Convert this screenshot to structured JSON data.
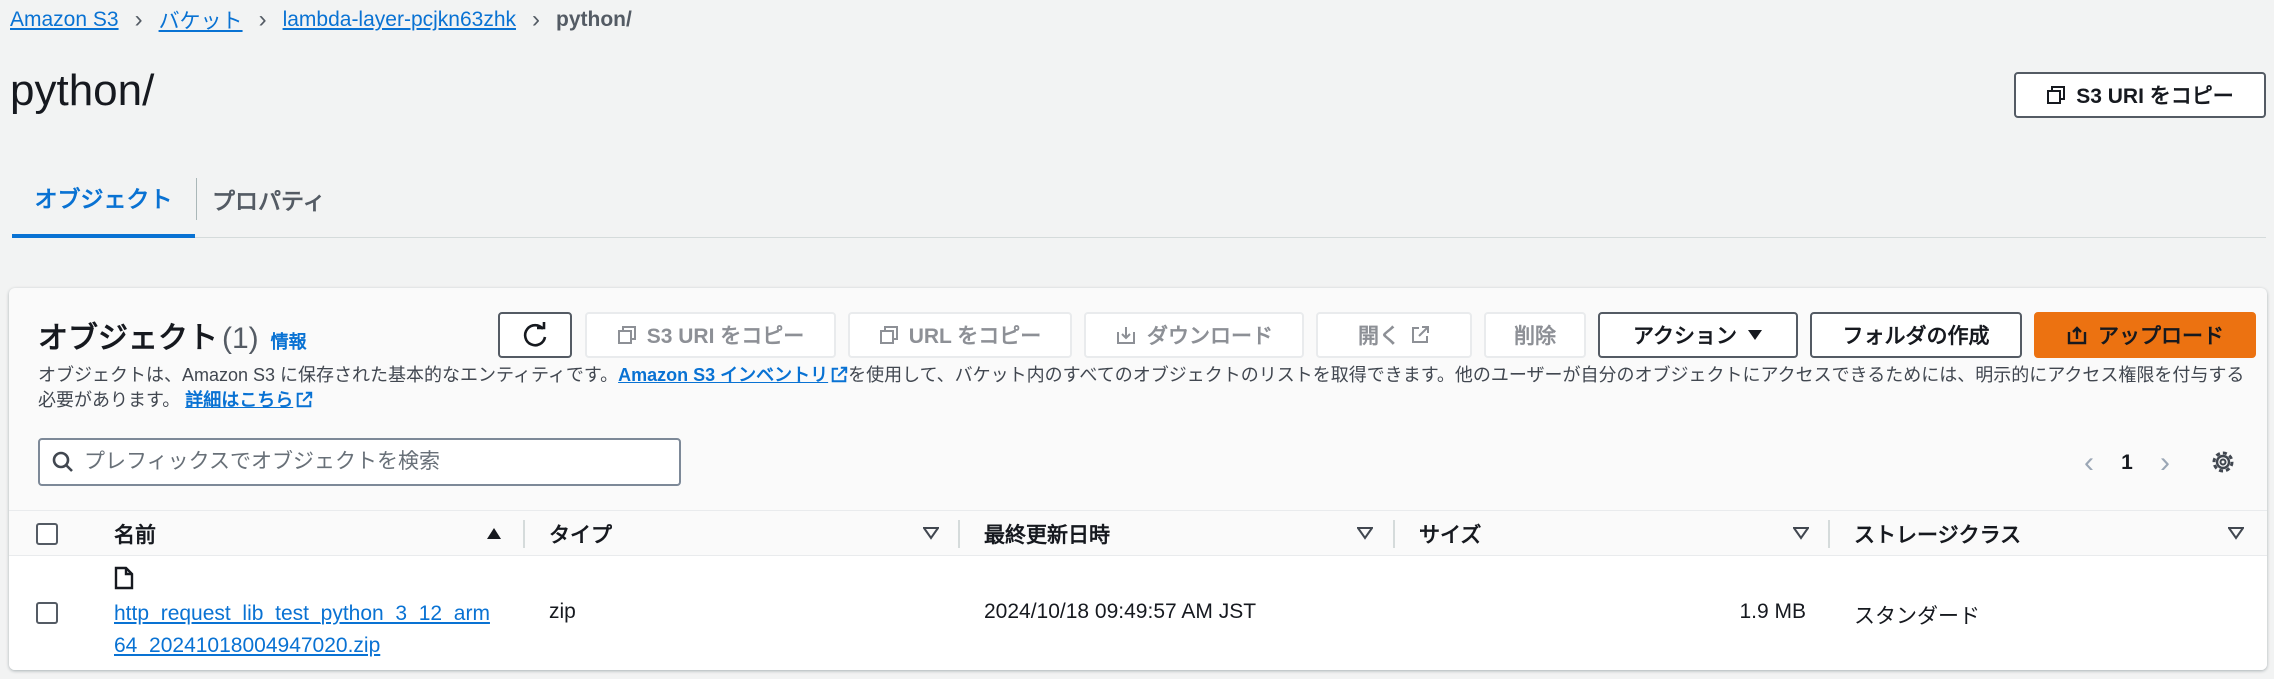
{
  "breadcrumb": {
    "items": [
      "Amazon S3",
      "バケット",
      "lambda-layer-pcjkn63zhk"
    ],
    "current": "python/"
  },
  "page": {
    "title": "python/",
    "copy_uri_label": "S3 URI をコピー"
  },
  "tabs": [
    {
      "label": "オブジェクト",
      "active": true
    },
    {
      "label": "プロパティ",
      "active": false
    }
  ],
  "objects": {
    "title": "オブジェクト",
    "count": "(1)",
    "info": "情報",
    "toolbar": {
      "copy_s3_uri": "S3 URI をコピー",
      "copy_url": "URL をコピー",
      "download": "ダウンロード",
      "open": "開く",
      "delete": "削除",
      "actions": "アクション",
      "create_folder": "フォルダの作成",
      "upload": "アップロード"
    },
    "description": {
      "part1": "オブジェクトは、Amazon S3 に保存された基本的なエンティティです。",
      "inventory_link": "Amazon S3 インベントリ",
      "part2": "を使用して、バケット内のすべてのオブジェクトのリストを取得できます。他のユーザーが自分のオブジェクトにアクセスできるためには、明示的にアクセス権限を付与する必要があります。",
      "details_link": "詳細はこちら"
    },
    "search_placeholder": "プレフィックスでオブジェクトを検索",
    "pagination": {
      "current_page": "1"
    },
    "columns": [
      "名前",
      "タイプ",
      "最終更新日時",
      "サイズ",
      "ストレージクラス"
    ],
    "rows": [
      {
        "name": "http_request_lib_test_python_3_12_arm64_20241018004947020.zip",
        "type": "zip",
        "last_modified": "2024/10/18 09:49:57 AM JST",
        "size": "1.9 MB",
        "storage_class": "スタンダード"
      }
    ]
  },
  "colors": {
    "link": "#0972d3",
    "primary": "#ec7211",
    "background": "#f2f3f3",
    "text": "#16191f"
  },
  "icons": [
    "chevron-right-icon",
    "copy-icon",
    "refresh-icon",
    "download-icon",
    "external-link-icon",
    "caret-down-icon",
    "upload-icon",
    "search-icon",
    "chevron-left-icon",
    "gear-icon",
    "sort-ascending-icon",
    "sort-descending-icon",
    "file-icon"
  ]
}
